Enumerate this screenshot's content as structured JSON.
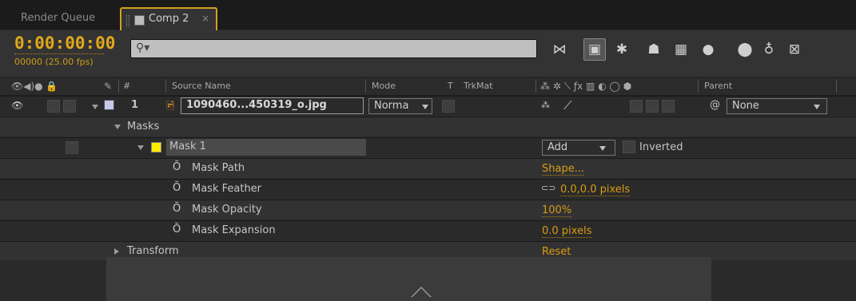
{
  "tabs": {
    "render_queue": "Render Queue",
    "comp": "Comp 2",
    "comp_close": "×"
  },
  "header": {
    "timecode": "0:00:00:00",
    "frame_info": "00000 (25.00 fps)",
    "search_placeholder": ""
  },
  "columns": {
    "num": "#",
    "source_name": "Source Name",
    "mode": "Mode",
    "t": "T",
    "trkmat": "TrkMat",
    "parent": "Parent"
  },
  "layer": {
    "number": "1",
    "name": "1090460...450319_o.jpg",
    "mode": "Norma",
    "parent": "None",
    "label_color": "#c8c8e8"
  },
  "groups": {
    "masks": "Masks",
    "mask1": "Mask 1",
    "mask1_color": "#ffea00",
    "mask_mode": "Add",
    "inverted": "Inverted",
    "transform": "Transform",
    "transform_value": "Reset"
  },
  "properties": [
    {
      "label": "Mask Path",
      "value": "Shape..."
    },
    {
      "label": "Mask Feather",
      "value": "0.0,0.0 pixels"
    },
    {
      "label": "Mask Opacity",
      "value": "100%"
    },
    {
      "label": "Mask Expansion",
      "value": "0.0 pixels"
    }
  ],
  "colors": {
    "accent": "#d4a21a",
    "value_orange": "#d99c14"
  }
}
